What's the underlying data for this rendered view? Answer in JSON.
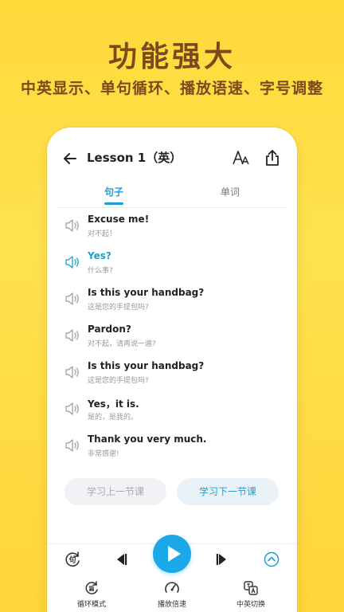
{
  "hero": {
    "title": "功能强大",
    "subtitle": "中英显示、单句循环、播放语速、字号调整"
  },
  "appbar": {
    "title": "Lesson 1（英）"
  },
  "tabs": [
    {
      "label": "句子",
      "active": true
    },
    {
      "label": "单词",
      "active": false
    }
  ],
  "sentences": [
    {
      "en": "Excuse me!",
      "cn": "对不起！",
      "active": false
    },
    {
      "en": "Yes?",
      "cn": "什么事?",
      "active": true
    },
    {
      "en": "Is this your handbag?",
      "cn": "这是您的手提包吗?",
      "active": false
    },
    {
      "en": "Pardon?",
      "cn": "对不起，请再说一遍?",
      "active": false
    },
    {
      "en": "Is this your handbag?",
      "cn": "这是您的手提包吗?",
      "active": false
    },
    {
      "en": "Yes，it is.",
      "cn": "是的，是我的。",
      "active": false
    },
    {
      "en": "Thank you very much.",
      "cn": "非常感谢!",
      "active": false
    }
  ],
  "buttons": {
    "prev_lesson": "学习上一节课",
    "next_lesson": "学习下一节课"
  },
  "functions": {
    "loop_mode": "循环模式",
    "speed": "播放倍速",
    "switch_lang": "中英切换",
    "loop_glyph": "篇",
    "sentence_glyph": "句"
  },
  "colors": {
    "background": "#FFD93A",
    "hero_text": "#7A4A1E",
    "accent": "#1AA0D8",
    "play_button": "#1AA8E8"
  },
  "icons": [
    "back-icon",
    "font-size-icon",
    "share-icon",
    "speaker-icon",
    "loop-sentence-icon",
    "previous-icon",
    "play-icon",
    "next-icon",
    "expand-icon",
    "loop-mode-icon",
    "speed-icon",
    "language-switch-icon"
  ]
}
